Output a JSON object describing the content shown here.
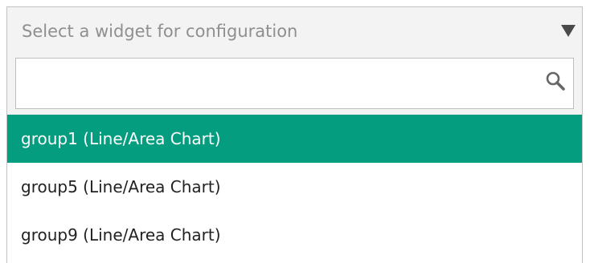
{
  "select": {
    "placeholder": "Select a widget for configuration",
    "caret_icon": "triangle-down-icon"
  },
  "search": {
    "value": "",
    "placeholder": "",
    "icon": "magnifier-icon"
  },
  "options": [
    {
      "label": "group1 (Line/Area Chart)",
      "selected": true
    },
    {
      "label": "group5 (Line/Area Chart)",
      "selected": false
    },
    {
      "label": "group9 (Line/Area Chart)",
      "selected": false
    }
  ],
  "colors": {
    "selected_bg": "#059d80",
    "selected_text": "#ffffff",
    "header_bg": "#f3f3f3",
    "placeholder_text": "#8f8f8f"
  }
}
